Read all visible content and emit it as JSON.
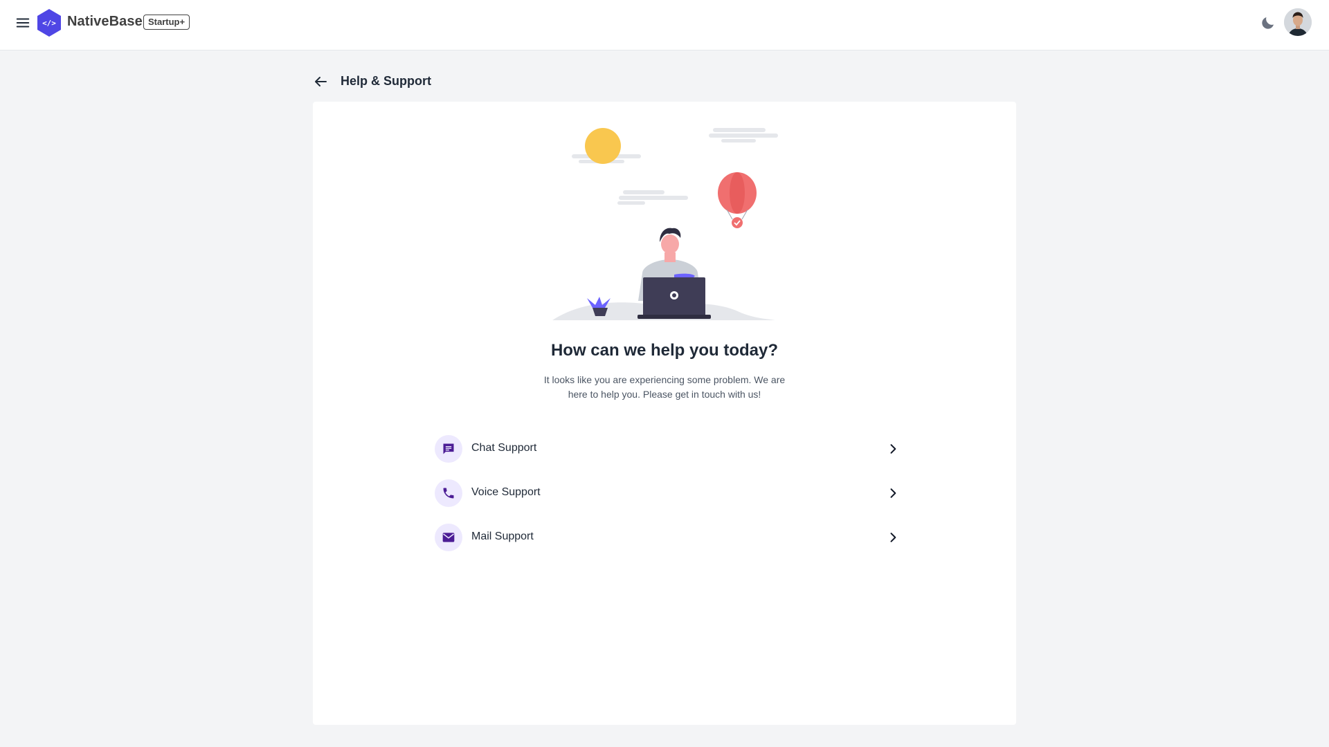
{
  "app": {
    "brand_name": "NativeBase",
    "badge": "Startup+",
    "accent_color": "#4f46e5"
  },
  "header": {
    "menu_icon": "hamburger-menu-icon",
    "theme_icon": "moon-icon",
    "avatar_icon": "user-avatar"
  },
  "page": {
    "title": "Help & Support",
    "back_icon": "arrow-left-icon"
  },
  "main": {
    "headline": "How can we help you today?",
    "subtext": "It looks like you are experiencing some problem. We are here to help you. Please get in touch with us!",
    "options": [
      {
        "label": "Chat Support",
        "icon": "chat-icon"
      },
      {
        "label": "Voice Support",
        "icon": "phone-icon"
      },
      {
        "label": "Mail Support",
        "icon": "mail-icon"
      }
    ]
  },
  "colors": {
    "icon_purple": "#4c1d95",
    "icon_bg": "#ede9fe",
    "page_bg": "#f3f4f6"
  }
}
